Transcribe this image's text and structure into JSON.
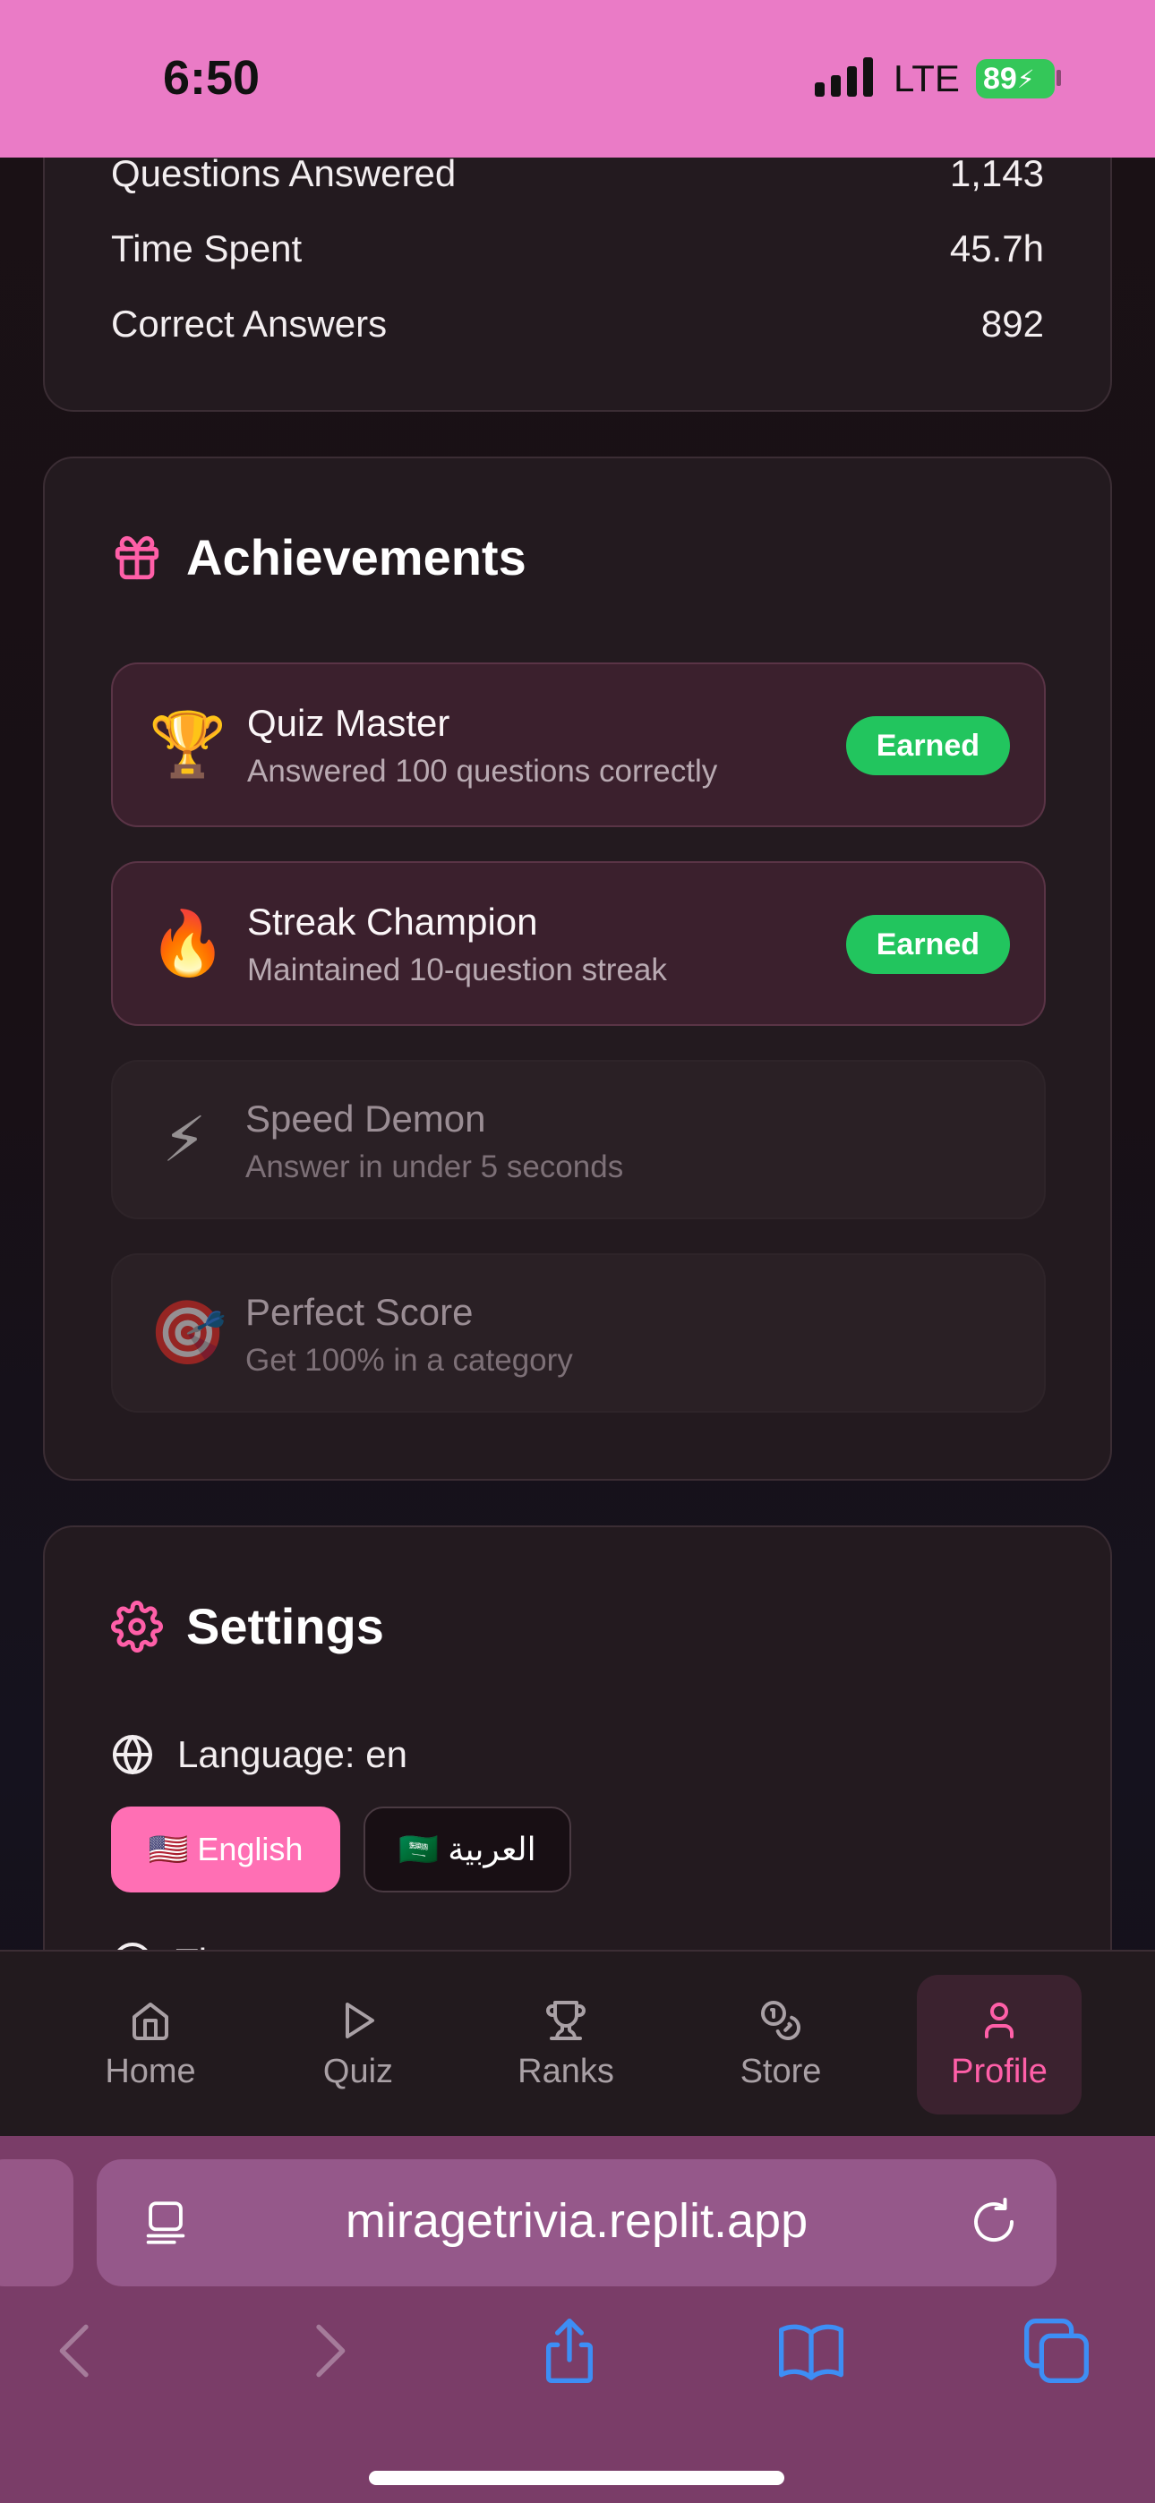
{
  "status_bar": {
    "time": "6:50",
    "network": "LTE",
    "battery": "89"
  },
  "stats": [
    {
      "label": "Questions Answered",
      "value": "1,143"
    },
    {
      "label": "Time Spent",
      "value": "45.7h"
    },
    {
      "label": "Correct Answers",
      "value": "892"
    }
  ],
  "achievements": {
    "title": "Achievements",
    "items": [
      {
        "icon": "🏆",
        "name": "Quiz Master",
        "description": "Answered 100 questions correctly",
        "badge": "Earned"
      },
      {
        "icon": "🔥",
        "name": "Streak Champion",
        "description": "Maintained 10-question streak",
        "badge": "Earned"
      },
      {
        "icon": "⚡",
        "name": "Speed Demon",
        "description": "Answer in under 5 seconds"
      },
      {
        "icon": "🎯",
        "name": "Perfect Score",
        "description": "Get 100% in a category"
      }
    ]
  },
  "settings": {
    "title": "Settings",
    "language_label": "Language: en",
    "english_label": "🇺🇸 English",
    "arabic_label": "🇸🇦 العربية",
    "theme_label_partial": "Th"
  },
  "nav": {
    "home": "Home",
    "quiz": "Quiz",
    "ranks": "Ranks",
    "store": "Store",
    "profile": "Profile"
  },
  "browser": {
    "url": "miragetrivia.replit.app"
  },
  "colors": {
    "accent": "#ff6fb4",
    "earned": "#22c55e",
    "status_bar": "#ea7bc6"
  }
}
